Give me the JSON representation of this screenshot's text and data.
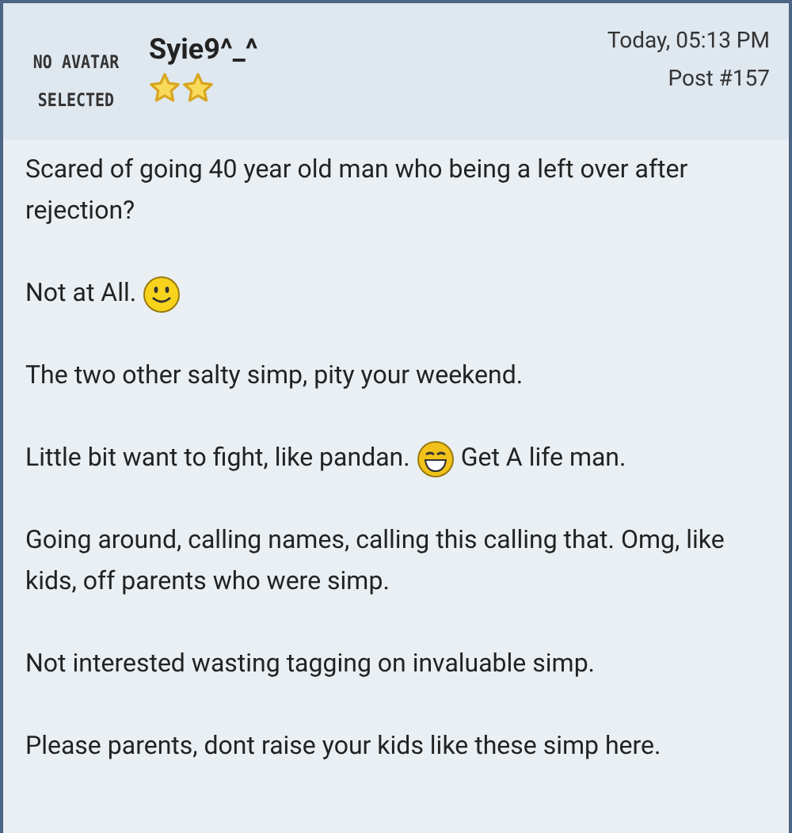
{
  "post": {
    "avatar_placeholder": "NO AVATAR SELECTED",
    "username": "Syie9^_^",
    "date": "Today, 05:13 PM",
    "post_number": "Post #157"
  },
  "paragraphs": [
    [
      {
        "kind": "text",
        "text": "Scared of going 40 year old man who being a left over after rejection?"
      }
    ],
    [
      {
        "kind": "text",
        "text": "Not at All."
      },
      {
        "kind": "smile"
      }
    ],
    [
      {
        "kind": "text",
        "text": "The two other salty simp, pity your weekend."
      }
    ],
    [
      {
        "kind": "text",
        "text": "Little bit want to fight, like pandan."
      },
      {
        "kind": "grin"
      },
      {
        "kind": "text",
        "text": "Get A life man."
      }
    ],
    [
      {
        "kind": "text",
        "text": "Going around, calling names, calling this calling that. Omg, like kids, off parents who were simp."
      }
    ],
    [
      {
        "kind": "text",
        "text": "Not interested wasting tagging on invaluable simp."
      }
    ],
    [
      {
        "kind": "text",
        "text": "Please parents, dont raise your kids like these simp here."
      }
    ]
  ]
}
